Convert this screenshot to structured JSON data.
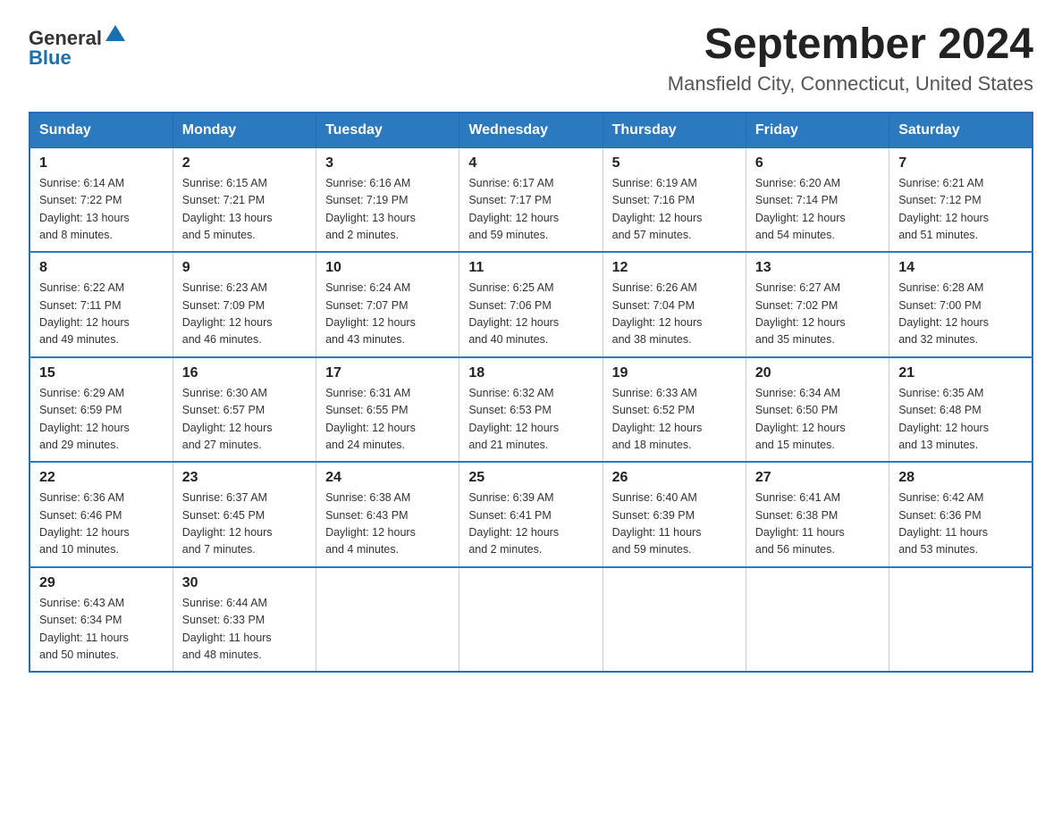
{
  "logo": {
    "text_general": "General",
    "text_blue": "Blue",
    "triangle_color": "#1a6faf"
  },
  "header": {
    "title": "September 2024",
    "subtitle": "Mansfield City, Connecticut, United States"
  },
  "days_of_week": [
    "Sunday",
    "Monday",
    "Tuesday",
    "Wednesday",
    "Thursday",
    "Friday",
    "Saturday"
  ],
  "weeks": [
    [
      {
        "day": "1",
        "info": "Sunrise: 6:14 AM\nSunset: 7:22 PM\nDaylight: 13 hours\nand 8 minutes."
      },
      {
        "day": "2",
        "info": "Sunrise: 6:15 AM\nSunset: 7:21 PM\nDaylight: 13 hours\nand 5 minutes."
      },
      {
        "day": "3",
        "info": "Sunrise: 6:16 AM\nSunset: 7:19 PM\nDaylight: 13 hours\nand 2 minutes."
      },
      {
        "day": "4",
        "info": "Sunrise: 6:17 AM\nSunset: 7:17 PM\nDaylight: 12 hours\nand 59 minutes."
      },
      {
        "day": "5",
        "info": "Sunrise: 6:19 AM\nSunset: 7:16 PM\nDaylight: 12 hours\nand 57 minutes."
      },
      {
        "day": "6",
        "info": "Sunrise: 6:20 AM\nSunset: 7:14 PM\nDaylight: 12 hours\nand 54 minutes."
      },
      {
        "day": "7",
        "info": "Sunrise: 6:21 AM\nSunset: 7:12 PM\nDaylight: 12 hours\nand 51 minutes."
      }
    ],
    [
      {
        "day": "8",
        "info": "Sunrise: 6:22 AM\nSunset: 7:11 PM\nDaylight: 12 hours\nand 49 minutes."
      },
      {
        "day": "9",
        "info": "Sunrise: 6:23 AM\nSunset: 7:09 PM\nDaylight: 12 hours\nand 46 minutes."
      },
      {
        "day": "10",
        "info": "Sunrise: 6:24 AM\nSunset: 7:07 PM\nDaylight: 12 hours\nand 43 minutes."
      },
      {
        "day": "11",
        "info": "Sunrise: 6:25 AM\nSunset: 7:06 PM\nDaylight: 12 hours\nand 40 minutes."
      },
      {
        "day": "12",
        "info": "Sunrise: 6:26 AM\nSunset: 7:04 PM\nDaylight: 12 hours\nand 38 minutes."
      },
      {
        "day": "13",
        "info": "Sunrise: 6:27 AM\nSunset: 7:02 PM\nDaylight: 12 hours\nand 35 minutes."
      },
      {
        "day": "14",
        "info": "Sunrise: 6:28 AM\nSunset: 7:00 PM\nDaylight: 12 hours\nand 32 minutes."
      }
    ],
    [
      {
        "day": "15",
        "info": "Sunrise: 6:29 AM\nSunset: 6:59 PM\nDaylight: 12 hours\nand 29 minutes."
      },
      {
        "day": "16",
        "info": "Sunrise: 6:30 AM\nSunset: 6:57 PM\nDaylight: 12 hours\nand 27 minutes."
      },
      {
        "day": "17",
        "info": "Sunrise: 6:31 AM\nSunset: 6:55 PM\nDaylight: 12 hours\nand 24 minutes."
      },
      {
        "day": "18",
        "info": "Sunrise: 6:32 AM\nSunset: 6:53 PM\nDaylight: 12 hours\nand 21 minutes."
      },
      {
        "day": "19",
        "info": "Sunrise: 6:33 AM\nSunset: 6:52 PM\nDaylight: 12 hours\nand 18 minutes."
      },
      {
        "day": "20",
        "info": "Sunrise: 6:34 AM\nSunset: 6:50 PM\nDaylight: 12 hours\nand 15 minutes."
      },
      {
        "day": "21",
        "info": "Sunrise: 6:35 AM\nSunset: 6:48 PM\nDaylight: 12 hours\nand 13 minutes."
      }
    ],
    [
      {
        "day": "22",
        "info": "Sunrise: 6:36 AM\nSunset: 6:46 PM\nDaylight: 12 hours\nand 10 minutes."
      },
      {
        "day": "23",
        "info": "Sunrise: 6:37 AM\nSunset: 6:45 PM\nDaylight: 12 hours\nand 7 minutes."
      },
      {
        "day": "24",
        "info": "Sunrise: 6:38 AM\nSunset: 6:43 PM\nDaylight: 12 hours\nand 4 minutes."
      },
      {
        "day": "25",
        "info": "Sunrise: 6:39 AM\nSunset: 6:41 PM\nDaylight: 12 hours\nand 2 minutes."
      },
      {
        "day": "26",
        "info": "Sunrise: 6:40 AM\nSunset: 6:39 PM\nDaylight: 11 hours\nand 59 minutes."
      },
      {
        "day": "27",
        "info": "Sunrise: 6:41 AM\nSunset: 6:38 PM\nDaylight: 11 hours\nand 56 minutes."
      },
      {
        "day": "28",
        "info": "Sunrise: 6:42 AM\nSunset: 6:36 PM\nDaylight: 11 hours\nand 53 minutes."
      }
    ],
    [
      {
        "day": "29",
        "info": "Sunrise: 6:43 AM\nSunset: 6:34 PM\nDaylight: 11 hours\nand 50 minutes."
      },
      {
        "day": "30",
        "info": "Sunrise: 6:44 AM\nSunset: 6:33 PM\nDaylight: 11 hours\nand 48 minutes."
      },
      {
        "day": "",
        "info": ""
      },
      {
        "day": "",
        "info": ""
      },
      {
        "day": "",
        "info": ""
      },
      {
        "day": "",
        "info": ""
      },
      {
        "day": "",
        "info": ""
      }
    ]
  ]
}
